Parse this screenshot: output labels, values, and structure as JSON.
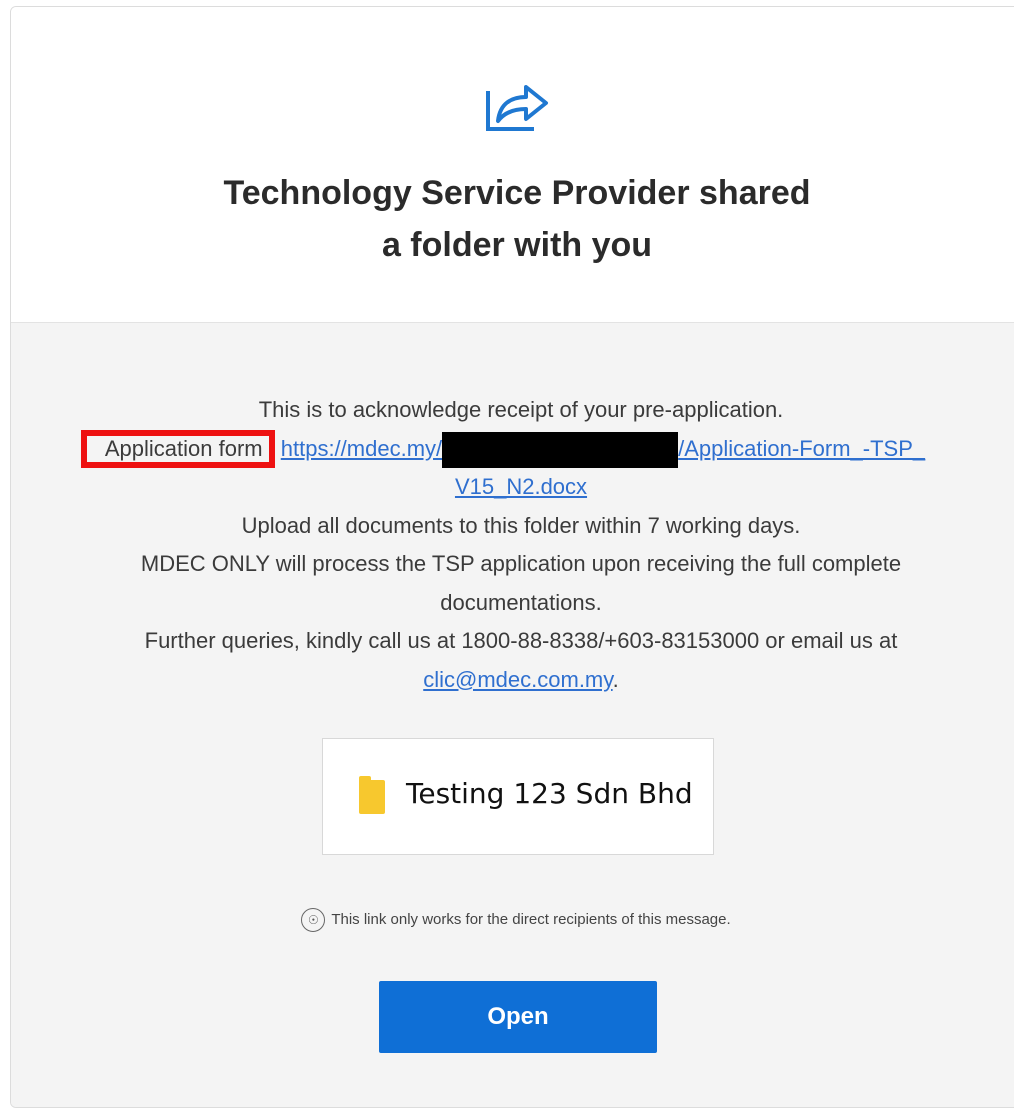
{
  "header": {
    "icon": "share-arrow-icon",
    "title_line1": "Technology Service Provider shared",
    "title_line2": "a folder with you"
  },
  "message": {
    "line1": "This is to acknowledge receipt of your pre-application.",
    "app_form_label": "Application form",
    "app_form_link_start": "https://mdec.my/",
    "app_form_link_end": "/Application-Form_-TSP_",
    "app_form_link_wrap": "V15_N2.docx",
    "line3": "Upload all documents to this folder within 7 working days.",
    "line4": "MDEC ONLY will process the TSP application upon receiving the full complete",
    "line5": "documentations.",
    "line6": "Further queries, kindly call us at 1800-88-8338/+603-83153000 or email us at",
    "email": "clic@mdec.com.my",
    "email_suffix": "."
  },
  "folder": {
    "icon": "folder-icon",
    "name": "Testing 123 Sdn Bhd"
  },
  "notice": {
    "icon": "people-icon",
    "text": "This link only works for the direct recipients of this message."
  },
  "actions": {
    "open_label": "Open"
  },
  "colors": {
    "link": "#2f6fcf",
    "button": "#0f6fd6",
    "highlight_box": "#ee1111",
    "folder": "#f7c82e"
  }
}
